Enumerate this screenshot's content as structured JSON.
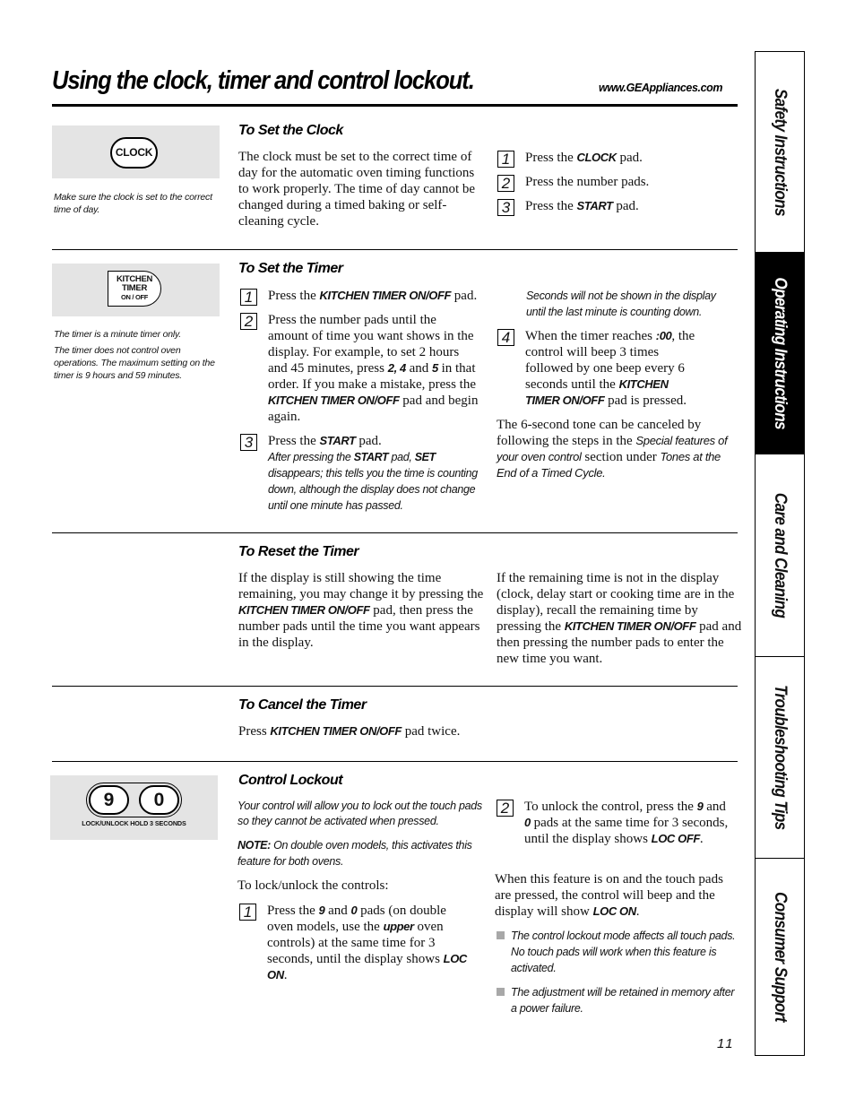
{
  "header": {
    "title": "Using the clock, timer and control lockout.",
    "url": "www.GEAppliances.com"
  },
  "side_tabs": [
    {
      "label": "Safety Instructions",
      "active": false
    },
    {
      "label": "Operating Instructions",
      "active": true
    },
    {
      "label": "Care and Cleaning",
      "active": false
    },
    {
      "label": "Troubleshooting Tips",
      "active": false
    },
    {
      "label": "Consumer Support",
      "active": false
    }
  ],
  "clock": {
    "pad_label": "CLOCK",
    "caption": "Make sure the clock is set to the correct time of day.",
    "heading": "To Set the Clock",
    "intro": "The clock must be set to the correct time of day for the automatic oven timing functions to work properly. The time of day cannot be changed during a timed baking or self-cleaning cycle.",
    "steps": [
      {
        "n": "1",
        "pre": "Press the ",
        "key": "CLOCK",
        "post": " pad."
      },
      {
        "n": "2",
        "pre": "Press the number pads.",
        "key": "",
        "post": ""
      },
      {
        "n": "3",
        "pre": "Press the ",
        "key": "START",
        "post": " pad."
      }
    ]
  },
  "timer": {
    "pad_lines": [
      "KITCHEN",
      "TIMER",
      "ON / OFF"
    ],
    "caption1": "The timer is a minute timer only.",
    "caption2": "The timer does not control oven operations. The maximum setting on the timer is 9 hours and 59 minutes.",
    "heading": "To Set the Timer",
    "step1": {
      "n": "1",
      "pre": "Press the ",
      "key": "KITCHEN TIMER ON/OFF",
      "post": " pad."
    },
    "step2": {
      "n": "2",
      "t1": "Press the number pads until the amount of time you want shows in the display. For example, to set 2 hours and 45 minutes, press ",
      "k1": "2, 4",
      "t2": " and ",
      "k2": "5",
      "t3": " in that order. If you make a mistake, press the ",
      "k3": "KITCHEN TIMER ON/OFF",
      "t4": " pad and begin again."
    },
    "step3": {
      "n": "3",
      "pre": "Press the ",
      "key": "START",
      "post": " pad.",
      "note_pre": "After pressing the ",
      "note_k1": "START",
      "note_mid": " pad, ",
      "note_k2": "SET",
      "note_post": " disappears; this tells you the time is counting down, although the display does not change until one minute has passed."
    },
    "seconds_note": "Seconds will not be shown in the display until the last minute is counting down.",
    "step4": {
      "n": "4",
      "t1": "When the timer reaches ",
      "k1": ":00",
      "t2": ", the control will beep 3 times followed by one beep every 6 seconds until the ",
      "k2": "KITCHEN TIMER ON/OFF",
      "t3": " pad is pressed."
    },
    "tone": {
      "t1": "The 6-second tone can be canceled by following the steps in the ",
      "i1": "Special features of your oven control",
      "t2": " section under ",
      "i2": "Tones at the End of a Timed Cycle."
    }
  },
  "reset": {
    "heading": "To Reset the Timer",
    "left": {
      "t1": "If the display is still showing the time remaining, you may change it by pressing the ",
      "key": "KITCHEN TIMER ON/OFF",
      "t2": " pad, then press the number pads until the time you want appears in the display."
    },
    "right": {
      "t1": "If the remaining time is not in the display (clock, delay start or cooking time are in the display), recall the remaining time by pressing the ",
      "key": "KITCHEN TIMER ON/OFF",
      "t2": " pad and then pressing the number pads to enter the new time you want."
    }
  },
  "cancel": {
    "heading": "To Cancel the Timer",
    "pre": "Press ",
    "key": "KITCHEN TIMER ON/OFF",
    "post": " pad twice."
  },
  "lockout": {
    "keys": [
      "9",
      "0"
    ],
    "key_caption": "LOCK/UNLOCK HOLD 3 SECONDS",
    "heading": "Control Lockout",
    "intro": "Your control will allow you to lock out the touch pads so they cannot be activated when pressed.",
    "note_label": "NOTE:",
    "note_text": " On double oven models, this activates this feature for both ovens.",
    "lead": "To lock/unlock the controls:",
    "step1": {
      "n": "1",
      "t1": "Press the ",
      "k1": "9",
      "t2": " and ",
      "k2": "0",
      "t3": " pads (on double oven models, use the ",
      "k3": "upper",
      "t4": " oven controls) at the same time for 3 seconds, until the display shows ",
      "k4": "LOC ON",
      "t5": "."
    },
    "step2": {
      "n": "2",
      "t1": "To unlock the control, press the ",
      "k1": "9",
      "t2": " and ",
      "k2": "0",
      "t3": " pads at the same time for 3 seconds, until the display shows ",
      "k3": "LOC OFF",
      "t4": "."
    },
    "feature": {
      "t1": "When this feature is on and the touch pads are pressed, the control will beep and the display will show ",
      "k1": "LOC ON",
      "t2": "."
    },
    "bullets": [
      "The control lockout mode affects all touch pads. No touch pads will work when this feature is activated.",
      "The adjustment will be retained in memory after a power failure."
    ]
  },
  "page_number": "11"
}
